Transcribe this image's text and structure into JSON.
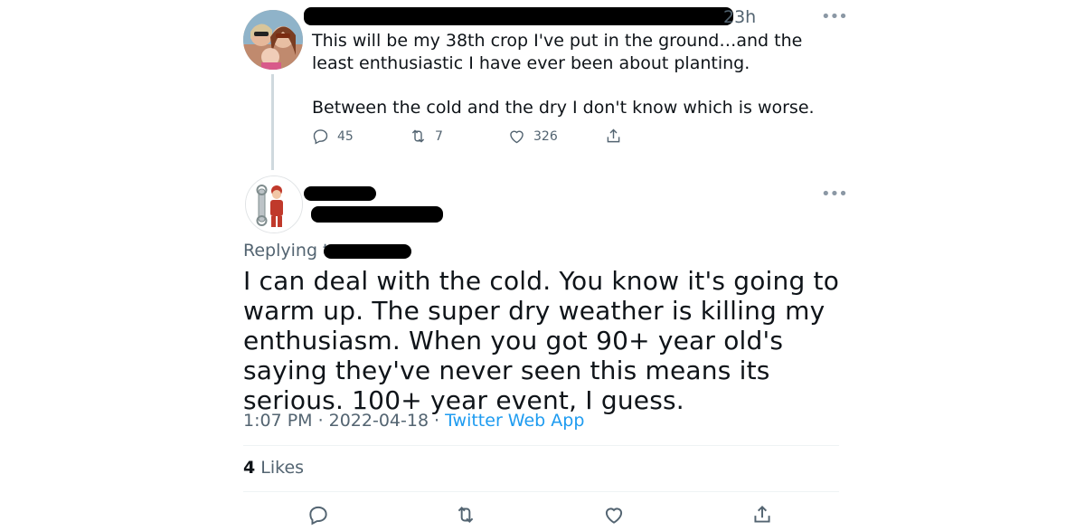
{
  "parent_tweet": {
    "time": "23h",
    "text_paragraphs": [
      "This will be my 38th crop I've put in the ground…and the least enthusiastic I have ever been about planting.",
      "Between the cold and the dry I don't know which is worse."
    ],
    "replies": "45",
    "retweets": "7",
    "likes": "326"
  },
  "reply_tweet": {
    "replying_to_label": "Replying to",
    "text": "I can deal with the cold. You know it's going to warm up. The super dry weather is killing my enthusiasm. When you got 90+ year old's saying they've never seen this means its serious. 100+ year event, I guess.",
    "time": "1:07 PM",
    "date": "2022-04-18",
    "source": "Twitter Web App",
    "likes_count": "4",
    "likes_label": "Likes"
  },
  "icons": {
    "more": "more-horizontal-icon",
    "reply": "reply-icon",
    "retweet": "retweet-icon",
    "like": "heart-icon",
    "share": "share-icon"
  },
  "colors": {
    "link": "#1d9bf0",
    "muted": "#536471",
    "text": "#0f1419"
  }
}
